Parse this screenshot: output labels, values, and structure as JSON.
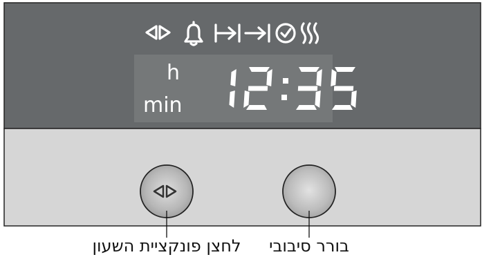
{
  "display": {
    "time": "12:35",
    "unit_hours": "h",
    "unit_minutes": "min",
    "status_icons": [
      "rotate-arrows-icon",
      "bell-icon",
      "cooking-time-icon",
      "end-time-icon",
      "clock-icon",
      "heating-icon"
    ]
  },
  "controls": {
    "function_button": {
      "caption": "לחצן פונקציית השעון",
      "icon": "rotate-arrows-icon"
    },
    "rotary_selector": {
      "caption": "בורר סיבובי"
    }
  },
  "colors": {
    "panel_dark": "#66696b",
    "lcd_window": "#757879",
    "panel_light": "#d6d6d6",
    "segment_lit": "#ffffff",
    "button_face": "#b3b3b3"
  }
}
